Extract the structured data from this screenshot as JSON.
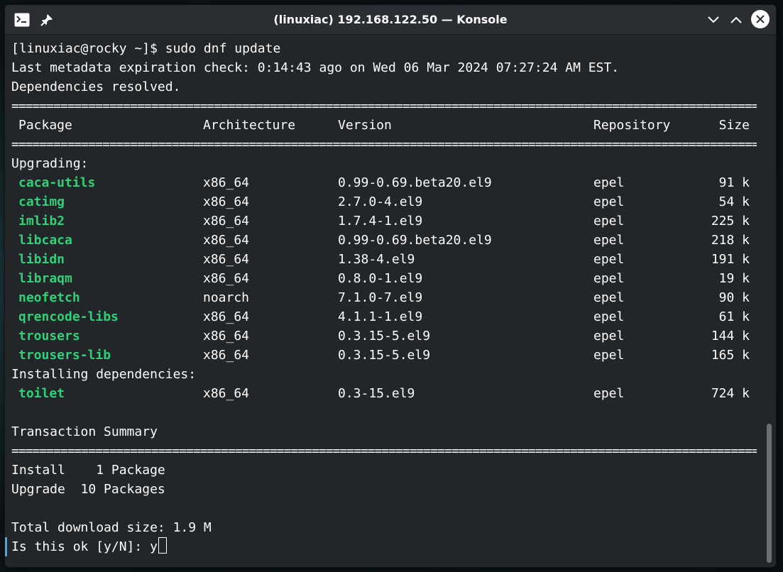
{
  "window": {
    "title": "(linuxiac) 192.168.122.50 — Konsole",
    "icons": {
      "app": "terminal-app-icon",
      "pin": "pin-icon",
      "minimize": "chevron-down-icon",
      "maximize": "chevron-up-icon",
      "close": "close-icon"
    }
  },
  "terminal": {
    "prompt_line": "[linuxiac@rocky ~]$ sudo dnf update",
    "metadata_line": "Last metadata expiration check: 0:14:43 ago on Wed 06 Mar 2024 07:27:24 AM EST.",
    "deps_line": "Dependencies resolved.",
    "separator": "================================================================================================================================",
    "table_headers": {
      "package": "Package",
      "architecture": "Architecture",
      "version": "Version",
      "repository": "Repository",
      "size": "Size"
    },
    "upgrading_label": "Upgrading:",
    "upgrading": [
      {
        "name": "caca-utils",
        "arch": "x86_64",
        "version": "0.99-0.69.beta20.el9",
        "repo": "epel",
        "size": "91 k"
      },
      {
        "name": "catimg",
        "arch": "x86_64",
        "version": "2.7.0-4.el9",
        "repo": "epel",
        "size": "54 k"
      },
      {
        "name": "imlib2",
        "arch": "x86_64",
        "version": "1.7.4-1.el9",
        "repo": "epel",
        "size": "225 k"
      },
      {
        "name": "libcaca",
        "arch": "x86_64",
        "version": "0.99-0.69.beta20.el9",
        "repo": "epel",
        "size": "218 k"
      },
      {
        "name": "libidn",
        "arch": "x86_64",
        "version": "1.38-4.el9",
        "repo": "epel",
        "size": "191 k"
      },
      {
        "name": "libraqm",
        "arch": "x86_64",
        "version": "0.8.0-1.el9",
        "repo": "epel",
        "size": "19 k"
      },
      {
        "name": "neofetch",
        "arch": "noarch",
        "version": "7.1.0-7.el9",
        "repo": "epel",
        "size": "90 k"
      },
      {
        "name": "qrencode-libs",
        "arch": "x86_64",
        "version": "4.1.1-1.el9",
        "repo": "epel",
        "size": "61 k"
      },
      {
        "name": "trousers",
        "arch": "x86_64",
        "version": "0.3.15-5.el9",
        "repo": "epel",
        "size": "144 k"
      },
      {
        "name": "trousers-lib",
        "arch": "x86_64",
        "version": "0.3.15-5.el9",
        "repo": "epel",
        "size": "165 k"
      }
    ],
    "installing_label": "Installing dependencies:",
    "installing": [
      {
        "name": "toilet",
        "arch": "x86_64",
        "version": "0.3-15.el9",
        "repo": "epel",
        "size": "724 k"
      }
    ],
    "summary_label": "Transaction Summary",
    "install_line": "Install    1 Package",
    "upgrade_line": "Upgrade  10 Packages",
    "download_line": "Total download size: 1.9 M",
    "confirm_line": "Is this ok [y/N]: y"
  },
  "colors": {
    "terminal_bg": "#232629",
    "text": "#fcfcfc",
    "package_name": "#2fd178"
  }
}
